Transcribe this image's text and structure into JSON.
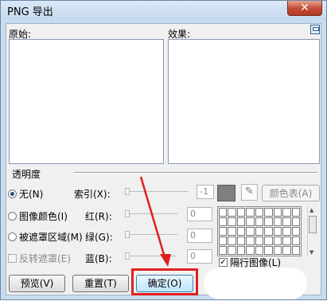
{
  "window": {
    "title": "PNG 导出",
    "close_label": "✕"
  },
  "panels": {
    "original_label": "原始:",
    "effect_label": "效果:"
  },
  "transparency": {
    "group_label": "透明度",
    "options": [
      {
        "label": "无(N)",
        "selected": true,
        "enabled": true
      },
      {
        "label": "图像颜色(I)",
        "selected": false,
        "enabled": true
      },
      {
        "label": "被遮罩区域(M)",
        "selected": false,
        "enabled": true
      }
    ],
    "invert_mask": {
      "label": "反转遮罩(E)",
      "checked": false,
      "enabled": false
    }
  },
  "channels": [
    {
      "label": "索引(X):",
      "value": "-1"
    },
    {
      "label": "红(R):",
      "value": "0"
    },
    {
      "label": "绿(G):",
      "value": "0"
    },
    {
      "label": "蓝(B):",
      "value": "0"
    }
  ],
  "color_swatch": {
    "color": "#7f7f7f"
  },
  "color_table_button": "颜色表(A)",
  "alternate_dithering": {
    "label": "隔行图像(L)",
    "checked": true
  },
  "buttons": {
    "preview": "预览(V)",
    "reset": "重置(T)",
    "ok": "确定(O)"
  },
  "annotation_color": "#e0201f"
}
